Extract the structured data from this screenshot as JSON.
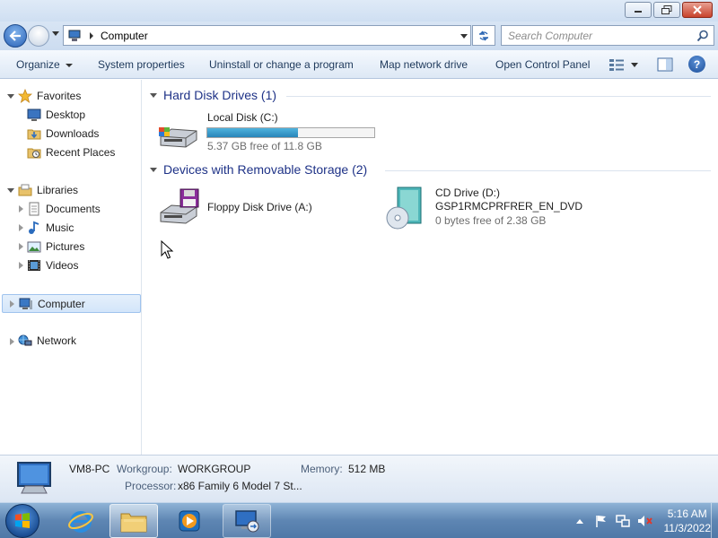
{
  "address": {
    "location": "Computer"
  },
  "search": {
    "placeholder": "Search Computer"
  },
  "toolbar": {
    "organize": "Organize",
    "system_properties": "System properties",
    "uninstall": "Uninstall or change a program",
    "map_drive": "Map network drive",
    "control_panel": "Open Control Panel"
  },
  "nav": {
    "favorites": "Favorites",
    "desktop": "Desktop",
    "downloads": "Downloads",
    "recent": "Recent Places",
    "libraries": "Libraries",
    "documents": "Documents",
    "music": "Music",
    "pictures": "Pictures",
    "videos": "Videos",
    "computer": "Computer",
    "network": "Network"
  },
  "groups": {
    "hdd": {
      "title": "Hard Disk Drives (1)",
      "drive_name": "Local Disk (C:)",
      "drive_free": "5.37 GB free of 11.8 GB",
      "used_fraction": 0.545
    },
    "removable": {
      "title": "Devices with Removable Storage (2)",
      "floppy_name": "Floppy Disk Drive (A:)",
      "cd_name": "CD Drive (D:)",
      "cd_label": "GSP1RMCPRFRER_EN_DVD",
      "cd_free": "0 bytes free of 2.38 GB"
    }
  },
  "details": {
    "computer_name": "VM8-PC",
    "workgroup_label": "Workgroup:",
    "workgroup_value": "WORKGROUP",
    "memory_label": "Memory:",
    "memory_value": "512 MB",
    "processor_label": "Processor:",
    "processor_value": "x86 Family 6 Model 7 St..."
  },
  "clock": {
    "time": "5:16 AM",
    "date": "11/3/2022"
  },
  "colors": {
    "accent": "#1e3287",
    "bar_fill": "#2885b8",
    "taskbar": "#5e86b3"
  }
}
